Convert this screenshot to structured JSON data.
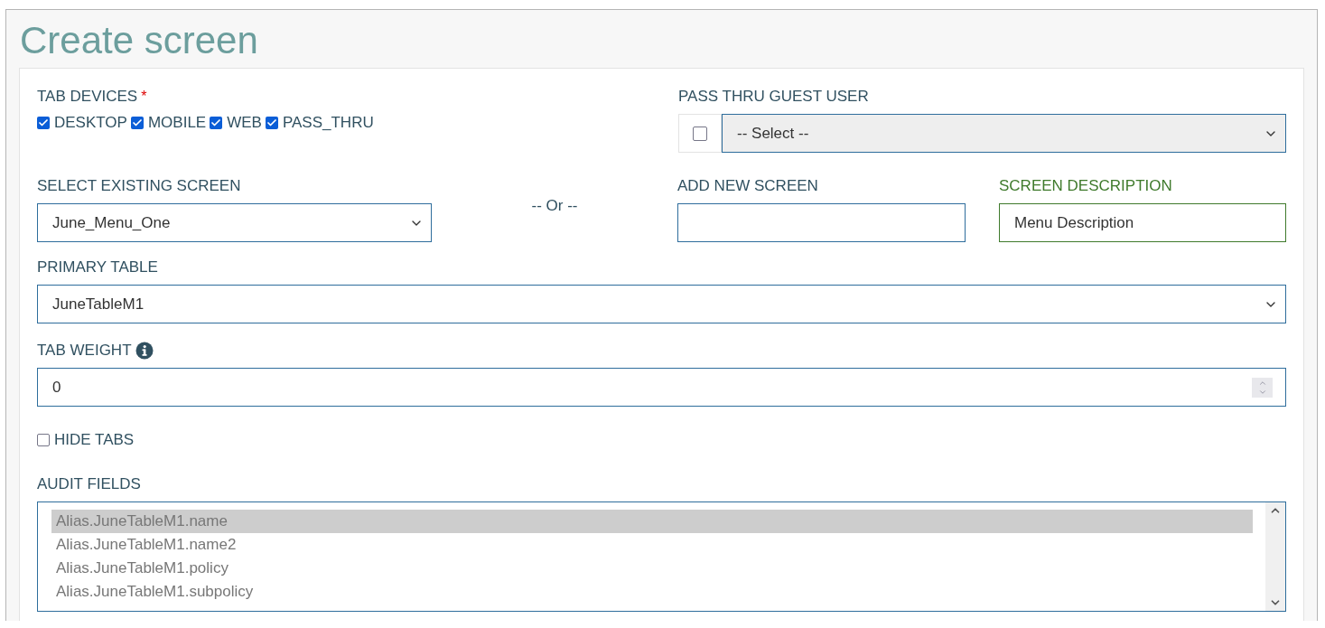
{
  "title": "Create screen",
  "tab_devices": {
    "label": "TAB DEVICES",
    "required_mark": "*",
    "options": [
      {
        "label": "DESKTOP",
        "checked": true
      },
      {
        "label": "MOBILE",
        "checked": true
      },
      {
        "label": "WEB",
        "checked": true
      },
      {
        "label": "PASS_THRU",
        "checked": true
      }
    ]
  },
  "pass_thru_guest_user": {
    "label": "PASS THRU GUEST USER",
    "checked": false,
    "value": "-- Select --"
  },
  "select_existing_screen": {
    "label": "SELECT EXISTING SCREEN",
    "value": "June_Menu_One"
  },
  "separator": "-- Or --",
  "add_new_screen": {
    "label": "ADD NEW SCREEN"
  },
  "screen_description": {
    "label": "SCREEN DESCRIPTION",
    "value": "Menu Description"
  },
  "primary_table": {
    "label": "PRIMARY TABLE",
    "value": "JuneTableM1"
  },
  "tab_weight": {
    "label": "TAB WEIGHT",
    "value": "0"
  },
  "hide_tabs": {
    "label": "HIDE TABS",
    "checked": false
  },
  "audit_fields": {
    "label": "AUDIT FIELDS",
    "items": [
      {
        "label": "Alias.JuneTableM1.name",
        "selected": true
      },
      {
        "label": "Alias.JuneTableM1.name2",
        "selected": false
      },
      {
        "label": "Alias.JuneTableM1.policy",
        "selected": false
      },
      {
        "label": "Alias.JuneTableM1.subpolicy",
        "selected": false
      }
    ]
  }
}
